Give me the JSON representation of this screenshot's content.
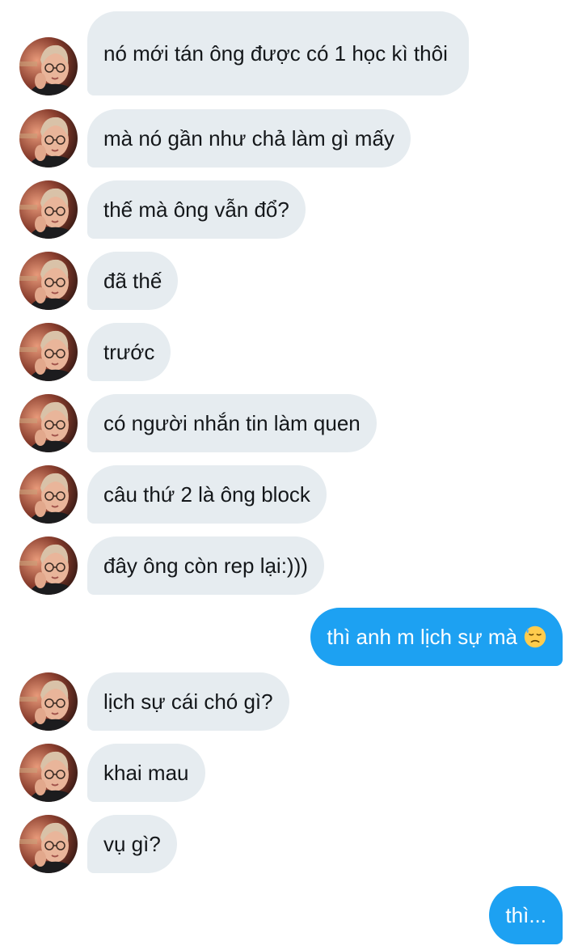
{
  "messages": [
    {
      "dir": "in",
      "text": "nó mới tán ông được có 1 học kì thôi"
    },
    {
      "dir": "in",
      "text": "mà nó gần như chả làm gì mấy"
    },
    {
      "dir": "in",
      "text": "thế mà ông vẫn đổ?"
    },
    {
      "dir": "in",
      "text": "đã thế"
    },
    {
      "dir": "in",
      "text": "trước"
    },
    {
      "dir": "in",
      "text": "có người nhắn tin làm quen"
    },
    {
      "dir": "in",
      "text": "câu thứ 2 là ông block"
    },
    {
      "dir": "in",
      "text": "đây ông còn rep lại:)))"
    },
    {
      "dir": "out",
      "text": "thì anh m lịch sự mà",
      "emoji": "downcast-sweat-face"
    },
    {
      "dir": "in",
      "text": "lịch sự cái chó gì?"
    },
    {
      "dir": "in",
      "text": "khai mau"
    },
    {
      "dir": "in",
      "text": "vụ gì?"
    },
    {
      "dir": "out",
      "text": "thì..."
    }
  ],
  "colors": {
    "incoming_bubble": "#e6ecf0",
    "outgoing_bubble": "#1da1f2",
    "incoming_text": "#14171a",
    "outgoing_text": "#ffffff"
  }
}
